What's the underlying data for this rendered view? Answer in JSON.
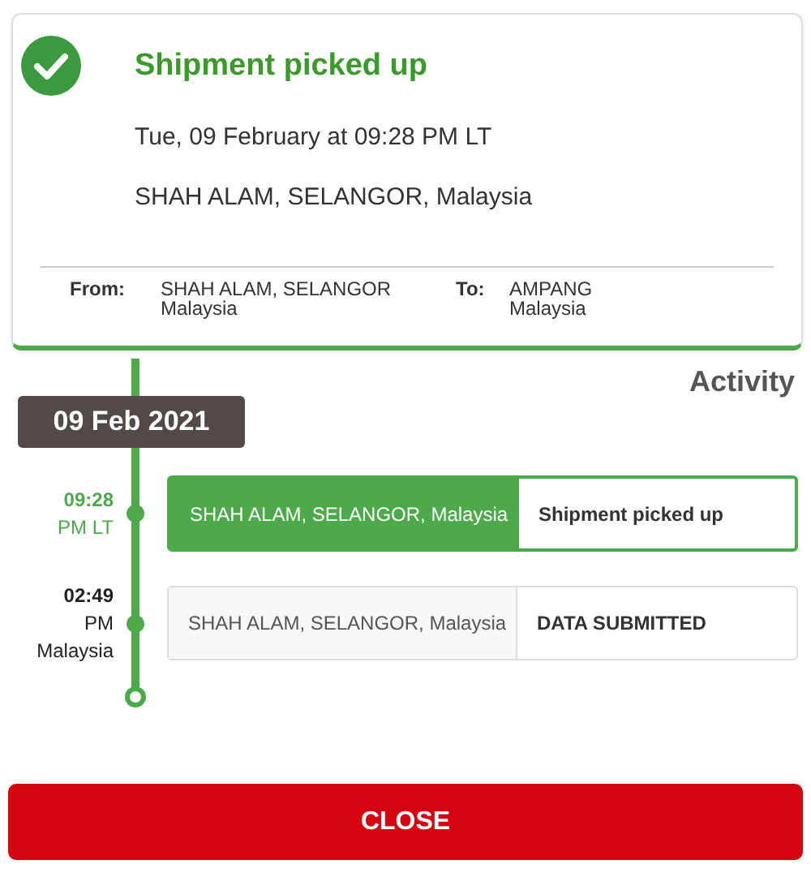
{
  "summary": {
    "title": "Shipment picked up",
    "datetime": "Tue, 09 February at 09:28 PM LT",
    "location": "SHAH ALAM, SELANGOR, Malaysia",
    "from_label": "From:",
    "from_value": [
      "SHAH ALAM, SELANGOR",
      "Malaysia"
    ],
    "to_label": "To:",
    "to_value": [
      "AMPANG",
      "Malaysia"
    ]
  },
  "activity": {
    "heading": "Activity",
    "date": "09 Feb 2021",
    "events": [
      {
        "time": "09:28",
        "zone": "PM LT",
        "location": "SHAH ALAM, SELANGOR, Malaysia",
        "status": "Shipment picked up",
        "selected": true
      },
      {
        "time": "02:49",
        "zone": "PM Malaysia",
        "location": "SHAH ALAM, SELANGOR, Malaysia",
        "status": "DATA SUBMITTED",
        "selected": false
      }
    ]
  },
  "close_button": "CLOSE"
}
